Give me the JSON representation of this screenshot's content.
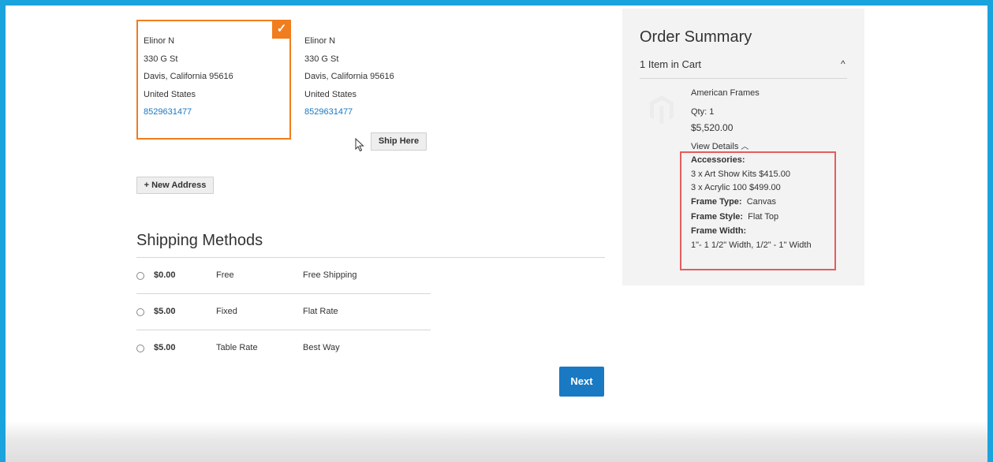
{
  "addresses": [
    {
      "name": "Elinor N",
      "street": "330 G St",
      "city_line": "Davis, California 95616",
      "country": "United States",
      "phone": "8529631477"
    },
    {
      "name": "Elinor N",
      "street": "330 G St",
      "city_line": "Davis, California 95616",
      "country": "United States",
      "phone": "8529631477"
    }
  ],
  "ship_here_label": "Ship Here",
  "new_address_label": "+ New Address",
  "shipping": {
    "title": "Shipping Methods",
    "methods": [
      {
        "price": "$0.00",
        "method": "Free",
        "carrier": "Free Shipping"
      },
      {
        "price": "$5.00",
        "method": "Fixed",
        "carrier": "Flat Rate"
      },
      {
        "price": "$5.00",
        "method": "Table Rate",
        "carrier": "Best Way"
      }
    ]
  },
  "next_label": "Next",
  "summary": {
    "title": "Order Summary",
    "count": "1 Item in Cart",
    "item": {
      "name": "American Frames",
      "qty": "Qty: 1",
      "price": "$5,520.00",
      "view_details": "View Details",
      "options": {
        "accessories_label": "Accessories:",
        "accessory_1": "3 x Art Show Kits $415.00",
        "accessory_2": "3 x Acrylic 100 $499.00",
        "frame_type_label": "Frame Type:",
        "frame_type_value": "Canvas",
        "frame_style_label": "Frame Style:",
        "frame_style_value": "Flat Top",
        "frame_width_label": "Frame Width:",
        "frame_width_value": "1\"- 1 1/2\" Width, 1/2\" - 1\" Width"
      }
    }
  },
  "icons": {
    "check": "check-icon",
    "chevron": "chevron-up-icon",
    "radio": "radio-icon",
    "placeholder": "magento-logo-icon",
    "cursor": "cursor-icon"
  },
  "colors": {
    "accent": "#1979c3",
    "selected_border": "#f07d1e",
    "highlight": "#e35d5d",
    "frame": "#1aa3dd"
  }
}
